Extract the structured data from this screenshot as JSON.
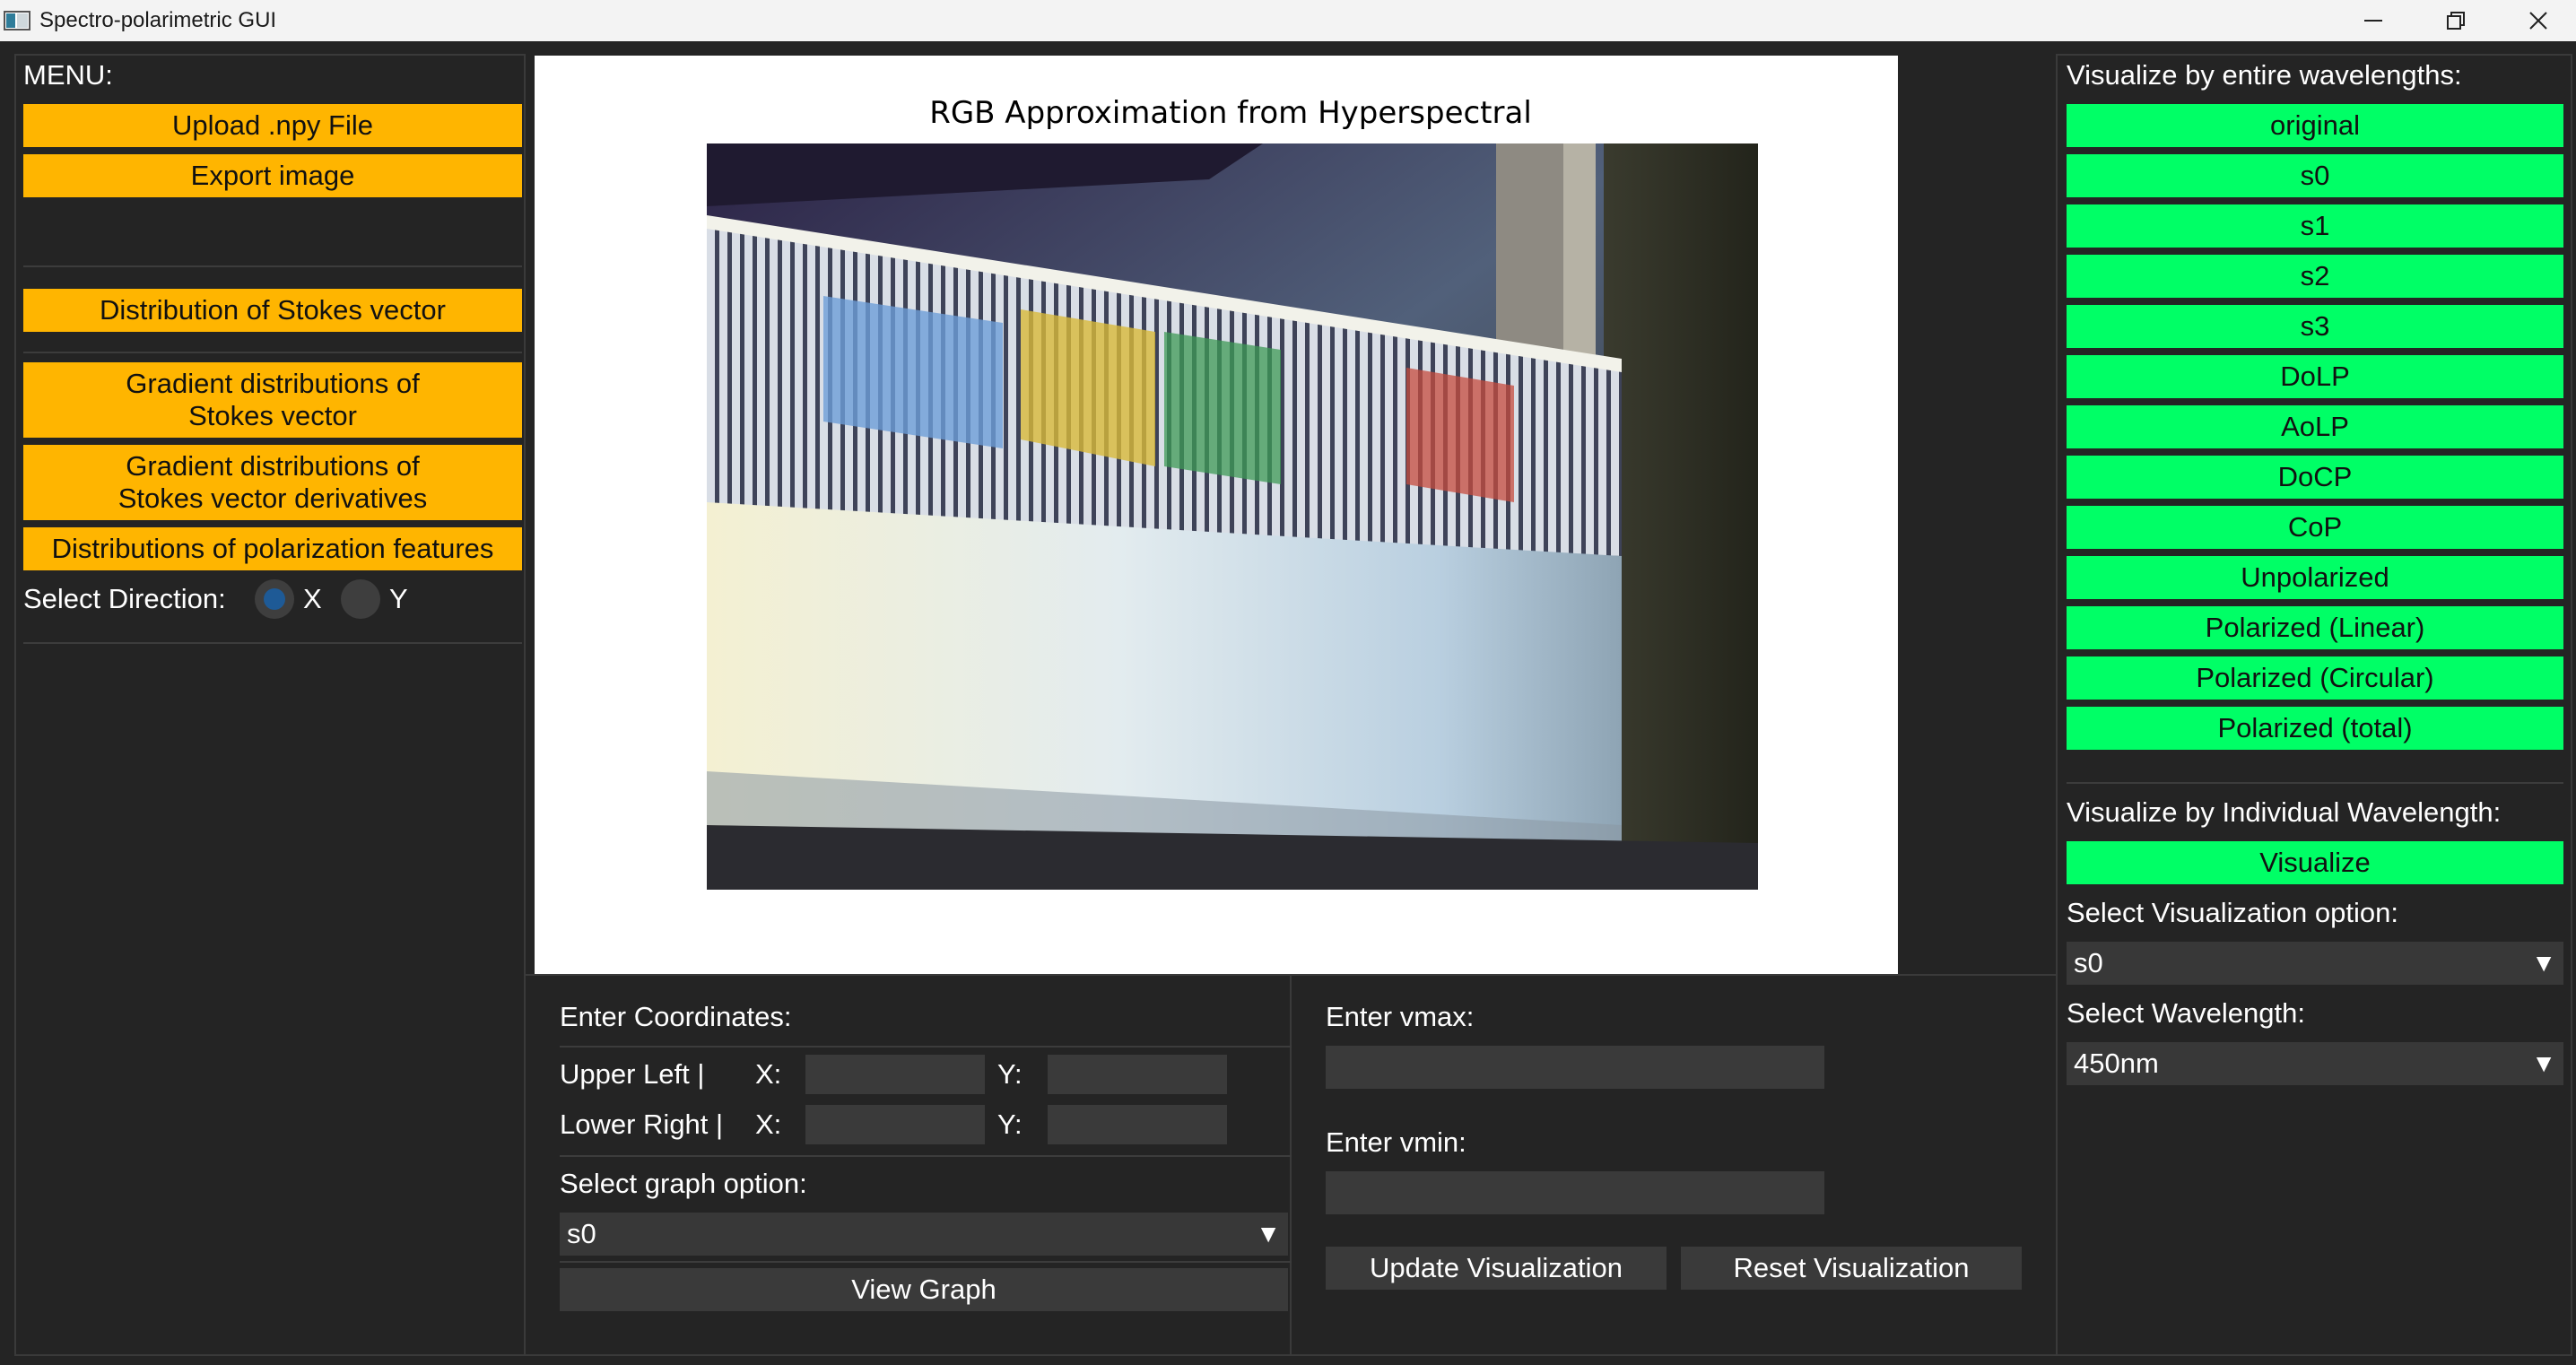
{
  "window": {
    "title": "Spectro-polarimetric GUI"
  },
  "left_menu": {
    "title": "MENU:",
    "upload_label": "Upload .npy File",
    "export_label": "Export image",
    "stokes_dist_label": "Distribution of Stokes vector",
    "gradient_stokes_line1": "Gradient distributions of",
    "gradient_stokes_line2": "Stokes vector",
    "gradient_deriv_line1": "Gradient distributions of",
    "gradient_deriv_line2": "Stokes vector derivatives",
    "polarization_features_label": "Distributions of polarization features",
    "direction_label": "Select Direction:",
    "direction_x": "X",
    "direction_y": "Y",
    "direction_selected": "X"
  },
  "plot": {
    "title": "RGB Approximation from Hyperspectral"
  },
  "coordinates": {
    "title": "Enter Coordinates:",
    "upper_left_label": "Upper Left    |",
    "lower_right_label": "Lower Right |",
    "x_label": "X:",
    "y_label": "Y:",
    "upper_left_x": "",
    "upper_left_y": "",
    "lower_right_x": "",
    "lower_right_y": "",
    "graph_option_label": "Select graph option:",
    "graph_option_value": "s0",
    "view_graph_label": "View Graph"
  },
  "vrange": {
    "vmax_label": "Enter vmax:",
    "vmin_label": "Enter vmin:",
    "vmax_value": "",
    "vmin_value": "",
    "update_label": "Update Visualization",
    "reset_label": "Reset Visualization"
  },
  "right_panel": {
    "entire_title": "Visualize by entire wavelengths:",
    "buttons": [
      "original",
      "s0",
      "s1",
      "s2",
      "s3",
      "DoLP",
      "AoLP",
      "DoCP",
      "CoP",
      "Unpolarized",
      "Polarized (Linear)",
      "Polarized (Circular)",
      "Polarized (total)"
    ],
    "individual_title": "Visualize by Individual Wavelength:",
    "visualize_label": "Visualize",
    "vis_option_label": "Select Visualization option:",
    "vis_option_value": "s0",
    "wavelength_label": "Select Wavelength:",
    "wavelength_value": "450nm"
  },
  "colors": {
    "background": "#242424",
    "menu_button": "#ffb500",
    "visualize_button": "#00ff66",
    "field": "#3a3a3a",
    "radio_selected": "#1e5a96"
  },
  "icons": [
    "app-icon",
    "minimize-icon",
    "restore-icon",
    "close-icon",
    "chevron-down-icon"
  ]
}
